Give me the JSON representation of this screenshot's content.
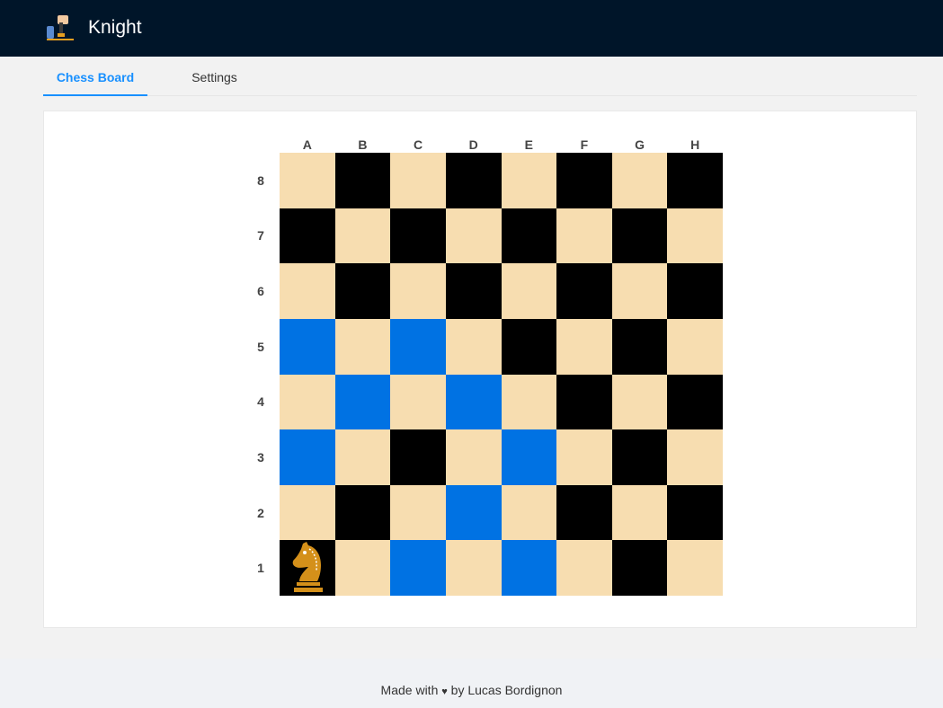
{
  "header": {
    "title": "Knight",
    "logo_icon": "chess-knight-hand-icon"
  },
  "tabs": [
    {
      "label": "Chess Board",
      "active": true
    },
    {
      "label": "Settings",
      "active": false
    }
  ],
  "board": {
    "files": [
      "A",
      "B",
      "C",
      "D",
      "E",
      "F",
      "G",
      "H"
    ],
    "ranks": [
      "8",
      "7",
      "6",
      "5",
      "4",
      "3",
      "2",
      "1"
    ],
    "colors": {
      "light": "#f7ddb0",
      "dark": "#000000",
      "highlight": "#0072e3",
      "piece": "#d4901a"
    },
    "knight_position": "A1",
    "highlighted_squares": [
      "A5",
      "C5",
      "B4",
      "D4",
      "A3",
      "E3",
      "D2",
      "C1",
      "E1"
    ]
  },
  "footer": {
    "prefix": "Made with",
    "heart": "♥",
    "suffix": "by Lucas Bordignon"
  }
}
